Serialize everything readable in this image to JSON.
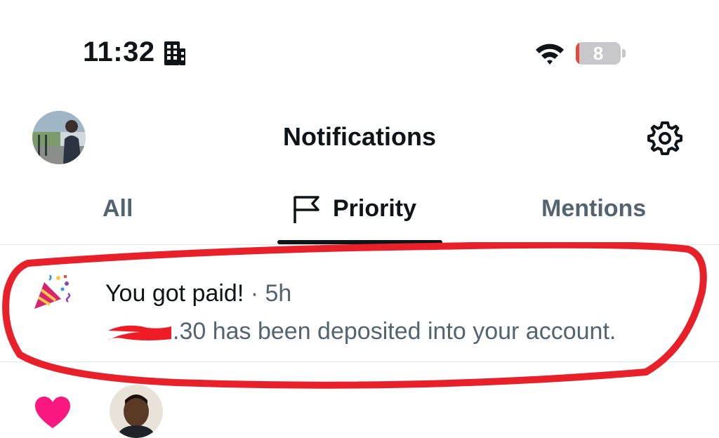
{
  "status_bar": {
    "time": "11:32",
    "battery_level": "8",
    "icons": [
      "building-icon",
      "wifi-icon",
      "battery-icon"
    ]
  },
  "header": {
    "title": "Notifications",
    "icons": [
      "avatar",
      "gear-icon"
    ]
  },
  "tabs": [
    {
      "label": "All",
      "active": false
    },
    {
      "label": "Priority",
      "active": true,
      "icon": "flag-icon"
    },
    {
      "label": "Mentions",
      "active": false
    }
  ],
  "notifications": [
    {
      "icon": "party-popper-icon",
      "title": "You got paid!",
      "separator": "·",
      "time": "5h",
      "body": ".30 has been deposited into your account."
    }
  ],
  "next_notification": {
    "icon": "heart-icon"
  },
  "colors": {
    "text_primary": "#0f1419",
    "text_secondary": "#536471",
    "annotation_red": "#e8202a",
    "heart": "#f91880",
    "battery_low": "#e5483d"
  }
}
